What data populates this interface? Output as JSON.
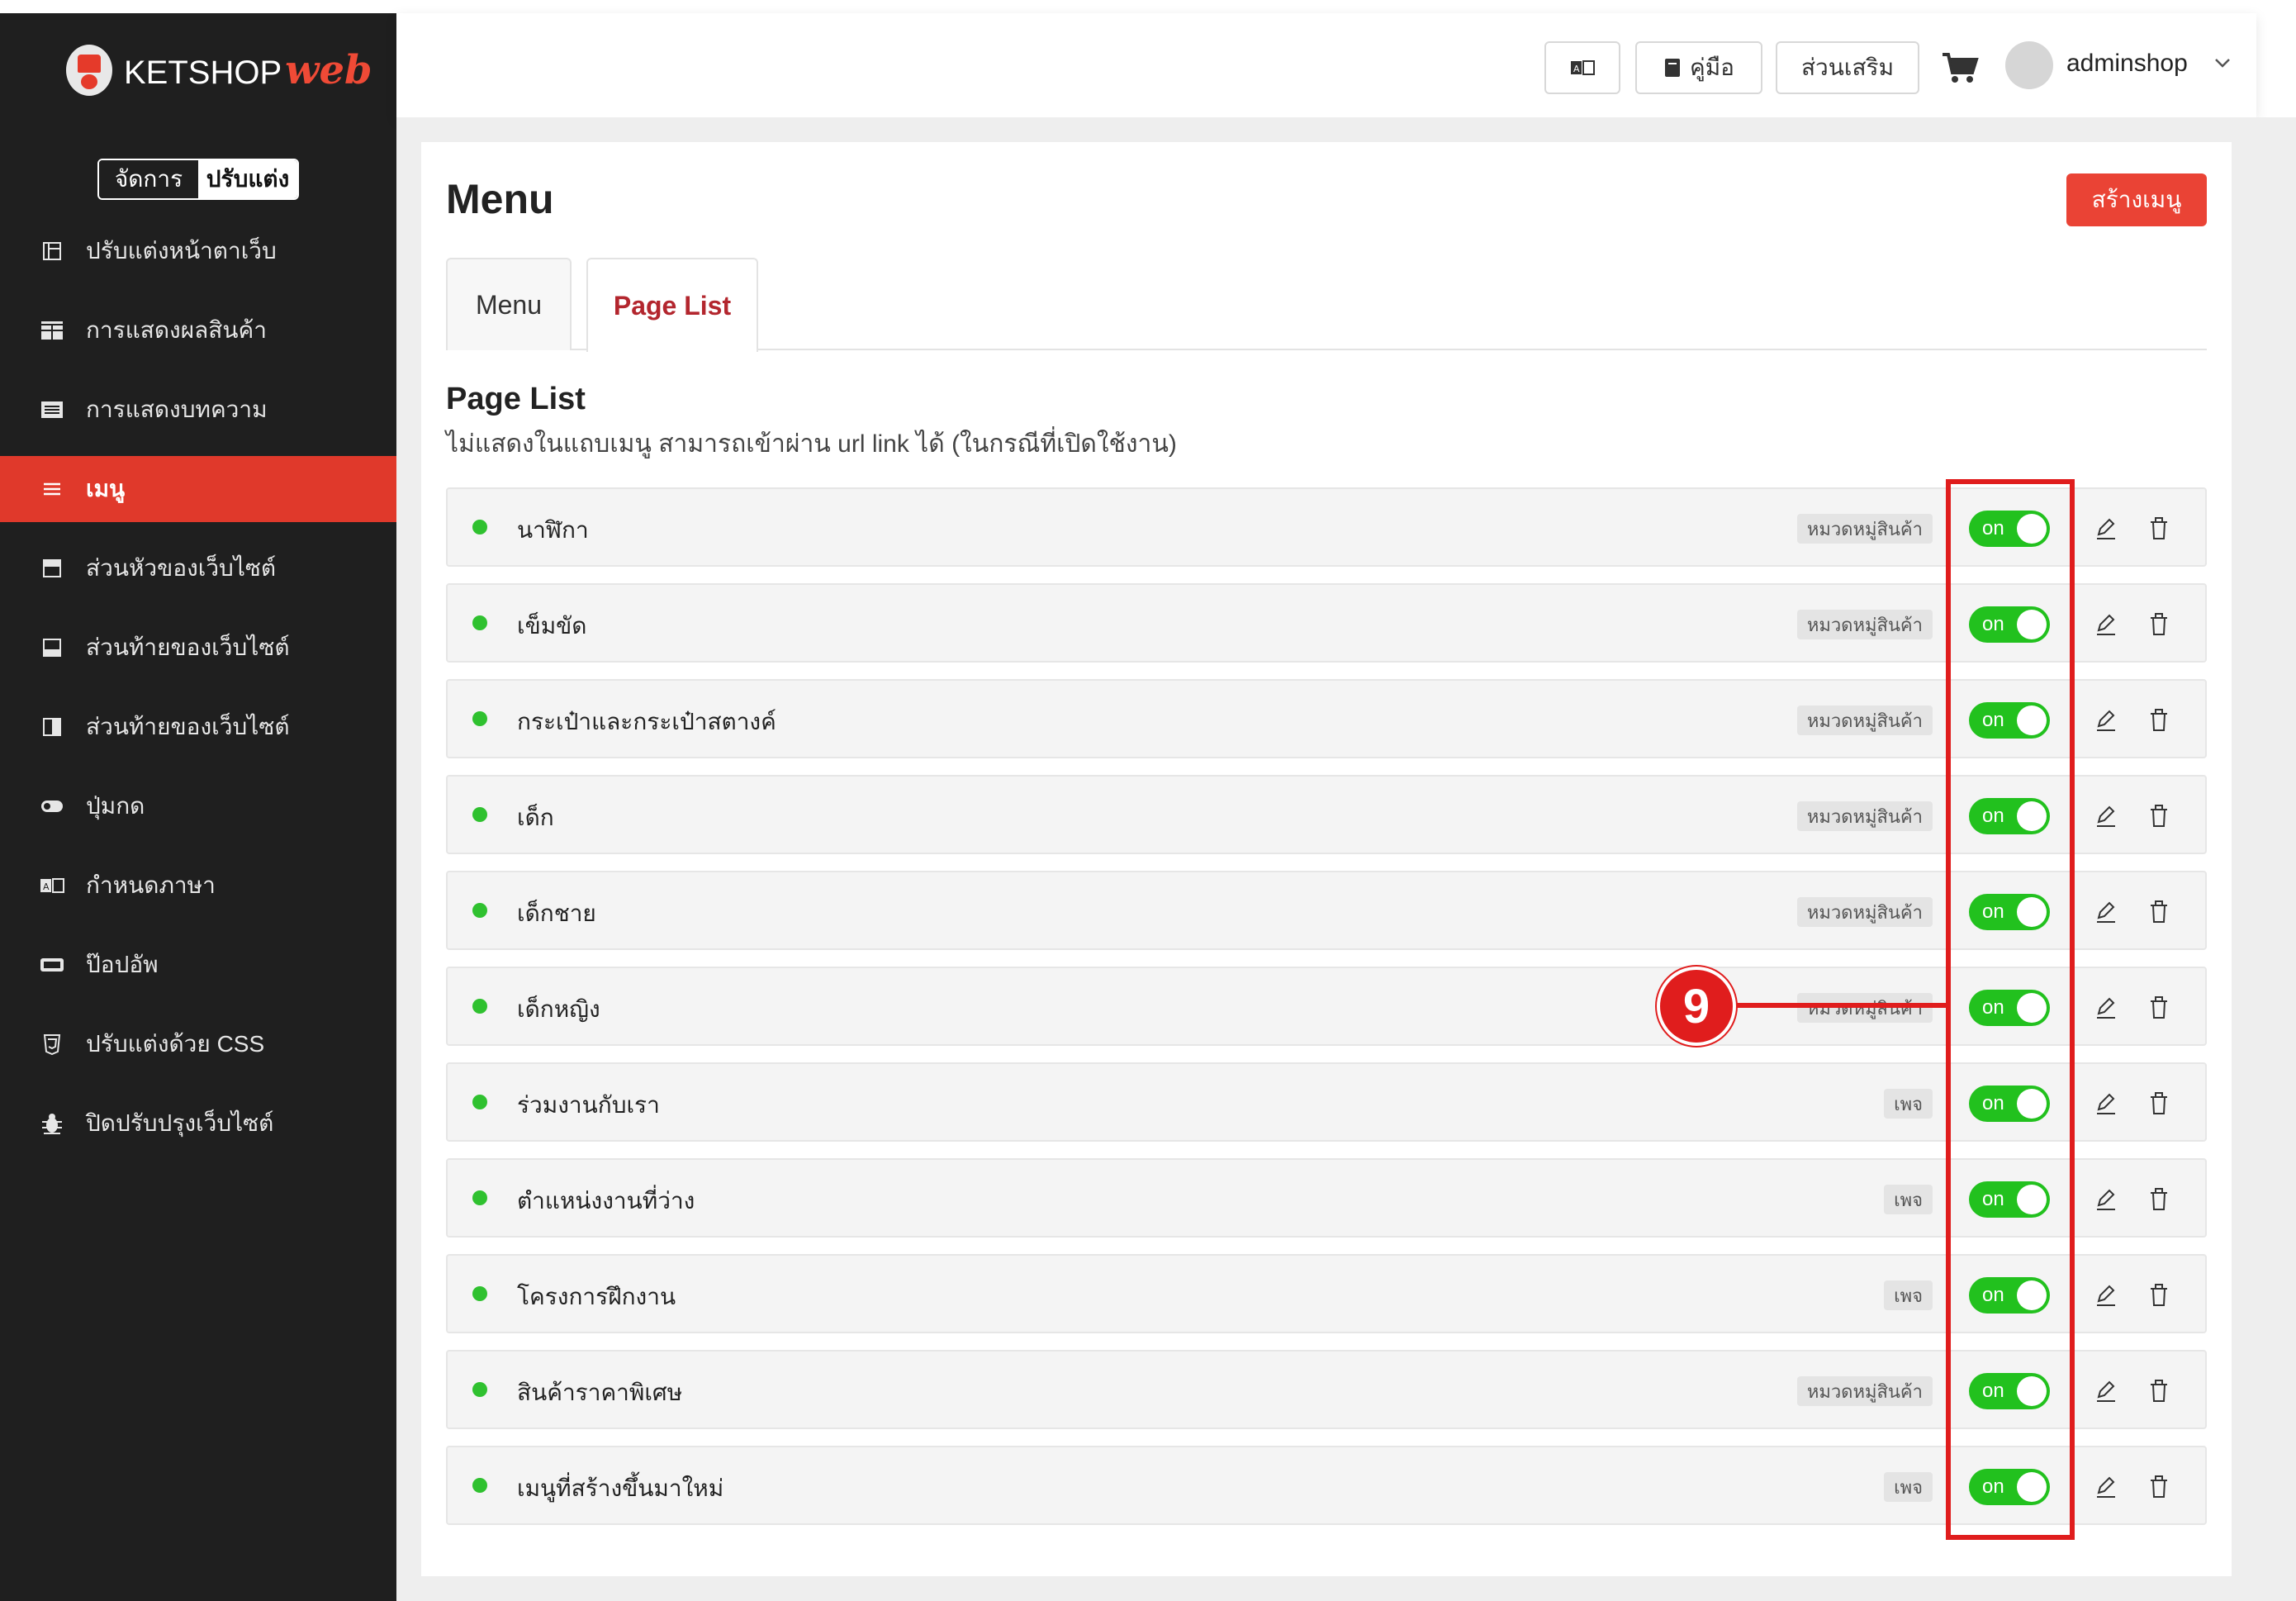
{
  "brand": {
    "name": "KETSHOP",
    "accent": "web",
    "colors": {
      "sidebar": "#1f1f1f",
      "active": "#e0392b",
      "toggle_on": "#22c11e",
      "annotation": "#e01d1d"
    }
  },
  "mode_toggle": {
    "manage": "จัดการ",
    "customize": "ปรับแต่ง"
  },
  "sidebar": {
    "items": [
      {
        "label": "ปรับแต่งหน้าตาเว็บ",
        "icon": "layout-icon"
      },
      {
        "label": "การแสดงผลสินค้า",
        "icon": "grid-icon"
      },
      {
        "label": "การแสดงบทความ",
        "icon": "article-icon"
      },
      {
        "label": "เมนู",
        "icon": "menu-icon",
        "active": true
      },
      {
        "label": "ส่วนหัวของเว็บไซต์",
        "icon": "header-icon"
      },
      {
        "label": "ส่วนท้ายของเว็บไซต์",
        "icon": "footer-icon"
      },
      {
        "label": "ส่วนท้ายของเว็บไซต์",
        "icon": "sidebar-icon"
      },
      {
        "label": "ปุ่มกด",
        "icon": "toggle-icon"
      },
      {
        "label": "กำหนดภาษา",
        "icon": "language-icon"
      },
      {
        "label": "ป๊อปอัพ",
        "icon": "popup-icon"
      },
      {
        "label": "ปรับแต่งด้วย CSS",
        "icon": "css-icon"
      },
      {
        "label": "ปิดปรับปรุงเว็บไซต์",
        "icon": "bug-icon"
      }
    ]
  },
  "topbar": {
    "manual": "คู่มือ",
    "addons": "ส่วนเสริม",
    "username": "adminshop"
  },
  "main": {
    "title": "Menu",
    "create_button": "สร้างเมนู",
    "tabs": [
      {
        "label": "Menu"
      },
      {
        "label": "Page List"
      }
    ],
    "section_title": "Page List",
    "section_desc": "ไม่แสดงในแถบเมนู สามารถเข้าผ่าน url link ได้ (ในกรณีที่เปิดใช้งาน)",
    "toggle_label": "on",
    "rows": [
      {
        "label": "นาฬิกา",
        "badge": "หมวดหมู่สินค้า"
      },
      {
        "label": "เข็มขัด",
        "badge": "หมวดหมู่สินค้า"
      },
      {
        "label": "กระเป๋าและกระเป๋าสตางค์",
        "badge": "หมวดหมู่สินค้า"
      },
      {
        "label": "เด็ก",
        "badge": "หมวดหมู่สินค้า"
      },
      {
        "label": "เด็กชาย",
        "badge": "หมวดหมู่สินค้า"
      },
      {
        "label": "เด็กหญิง",
        "badge": "หมวดหมู่สินค้า"
      },
      {
        "label": "ร่วมงานกับเรา",
        "badge": "เพจ"
      },
      {
        "label": "ตำแหน่งงานที่ว่าง",
        "badge": "เพจ"
      },
      {
        "label": "โครงการฝึกงาน",
        "badge": "เพจ"
      },
      {
        "label": "สินค้าราคาพิเศษ",
        "badge": "หมวดหมู่สินค้า"
      },
      {
        "label": "เมนูที่สร้างขึ้นมาใหม่",
        "badge": "เพจ"
      }
    ]
  },
  "annotation": {
    "number": "9"
  }
}
